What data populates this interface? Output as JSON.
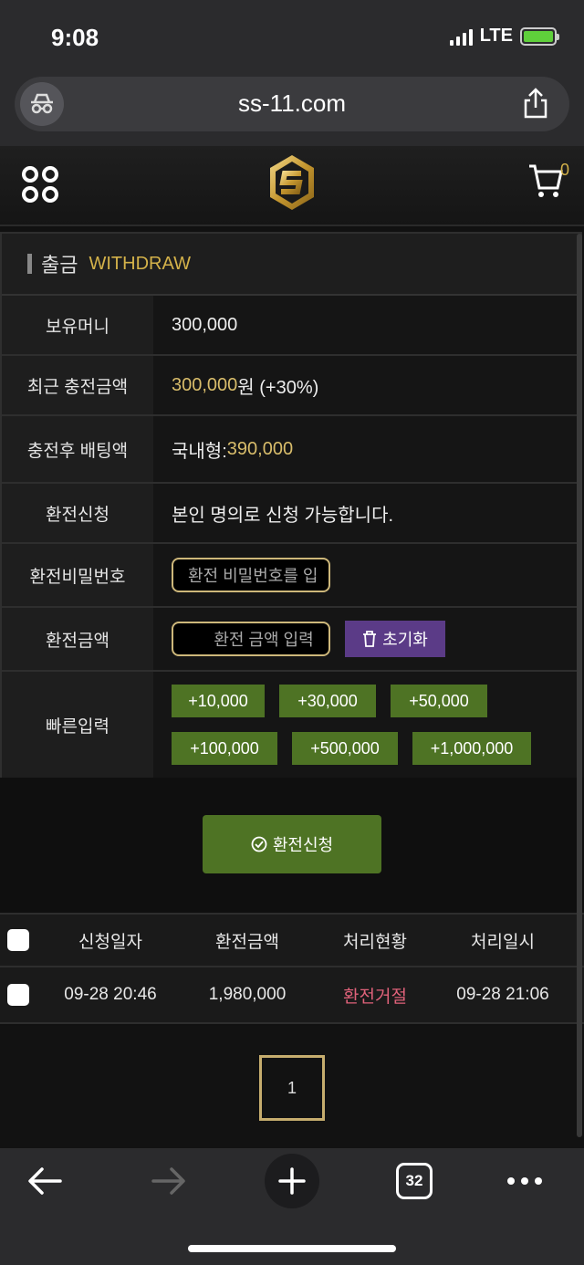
{
  "status": {
    "time": "9:08",
    "network": "LTE"
  },
  "browser": {
    "url": "ss-11.com",
    "tab_count": "32"
  },
  "site": {
    "cart_count": "0"
  },
  "panel": {
    "title_ko": "출금",
    "title_en": "WITHDRAW"
  },
  "rows": {
    "balance": {
      "label": "보유머니",
      "value": "300,000"
    },
    "recent_charge": {
      "label": "최근 충전금액",
      "amount": "300,000",
      "suffix": "원 (+30%)"
    },
    "betting": {
      "label": "충전후 배팅액",
      "prefix": "국내형:",
      "amount": "390,000"
    },
    "request_note": {
      "label": "환전신청",
      "value": "본인 명의로 신청 가능합니다."
    },
    "password": {
      "label": "환전비밀번호",
      "placeholder": "환전 비밀번호를 입"
    },
    "amount": {
      "label": "환전금액",
      "placeholder": "환전 금액 입력",
      "reset_label": "초기화"
    },
    "quick": {
      "label": "빠른입력",
      "buttons": [
        "+10,000",
        "+30,000",
        "+50,000",
        "+100,000",
        "+500,000",
        "+1,000,000"
      ]
    }
  },
  "submit": {
    "label": "환전신청"
  },
  "table": {
    "headers": [
      "신청일자",
      "환전금액",
      "처리현황",
      "처리일시"
    ],
    "rows": [
      {
        "date": "09-28 20:46",
        "amount": "1,980,000",
        "status": "환전거절",
        "processed": "09-28 21:06"
      }
    ]
  },
  "pagination": {
    "current": "1"
  },
  "colors": {
    "accent_gold": "#d4b24a",
    "button_green": "#4e7324",
    "reset_purple": "#5b3b87",
    "rejected_pink": "#e0627a"
  }
}
